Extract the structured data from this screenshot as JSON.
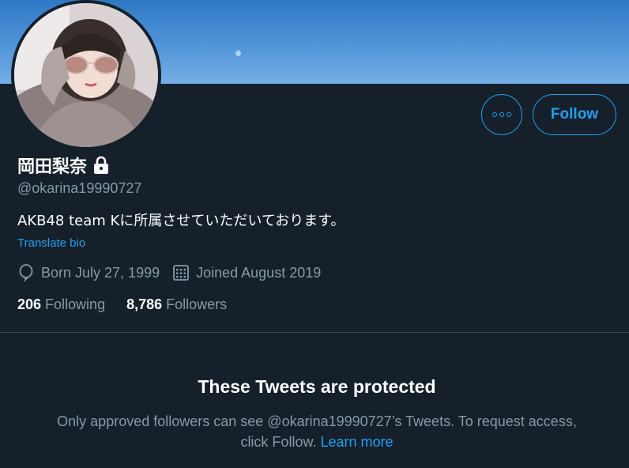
{
  "profile": {
    "display_name": "岡田梨奈",
    "handle": "@okarina19990727",
    "bio": "AKB48 team Kに所属させていただいております。",
    "translate_label": "Translate bio",
    "born": "Born July 27, 1999",
    "joined": "Joined August 2019",
    "following_count": "206",
    "following_label": "Following",
    "followers_count": "8,786",
    "followers_label": "Followers"
  },
  "actions": {
    "follow_label": "Follow",
    "more_icon": "more-dots-icon"
  },
  "protected": {
    "title": "These Tweets are protected",
    "body_line1": "Only approved followers can see @okarina19990727’s Tweets. To request access,",
    "body_line2": "click Follow.",
    "learn_more": "Learn more"
  },
  "icons": {
    "lock": "lock-icon",
    "birthday": "balloon-icon",
    "joined": "calendar-icon"
  },
  "colors": {
    "background": "#15202b",
    "accent": "#1da1f2",
    "muted_text": "#8899a6",
    "divider": "#38444d"
  }
}
